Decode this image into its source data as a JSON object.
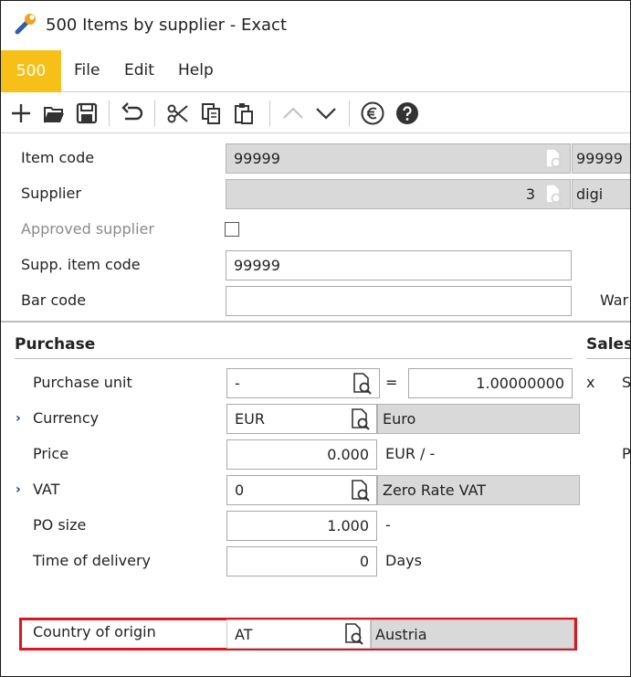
{
  "window": {
    "title": "500 Items by supplier - Exact",
    "app_icon": "wrench-icon"
  },
  "menu": {
    "code": "500",
    "items": [
      "File",
      "Edit",
      "Help"
    ]
  },
  "toolbar": {
    "icons": [
      "plus-icon",
      "folder-open-icon",
      "save-icon",
      "undo-icon",
      "cut-icon",
      "copy-icon",
      "paste-icon",
      "chevron-up-icon",
      "chevron-down-icon",
      "euro-icon",
      "help-icon"
    ]
  },
  "header": {
    "item_code": {
      "label": "Item code",
      "value": "99999",
      "description": "99999"
    },
    "supplier": {
      "label": "Supplier",
      "value": "3",
      "description": "digi"
    },
    "approved_supplier": {
      "label": "Approved supplier",
      "checked": false
    },
    "supp_item_code": {
      "label": "Supp. item code",
      "value": "99999"
    },
    "bar_code": {
      "label": "Bar code",
      "value": ""
    },
    "warehouse_label": "War"
  },
  "purchase": {
    "title": "Purchase",
    "purchase_unit": {
      "label": "Purchase unit",
      "value": "-",
      "equals": "=",
      "factor": "1.00000000",
      "times": "x"
    },
    "currency": {
      "label": "Currency",
      "value": "EUR",
      "description": "Euro"
    },
    "price": {
      "label": "Price",
      "value": "0.000",
      "unit": "EUR / -"
    },
    "vat": {
      "label": "VAT",
      "value": "0",
      "description": "Zero Rate VAT"
    },
    "po_size": {
      "label": "PO size",
      "value": "1.000",
      "unit": "-"
    },
    "time_of_delivery": {
      "label": "Time of delivery",
      "value": "0",
      "unit": "Days"
    },
    "country_of_origin": {
      "label": "Country of origin",
      "value": "AT",
      "description": "Austria"
    }
  },
  "sales": {
    "title": "Sales",
    "label_s": "S",
    "label_p": "P"
  },
  "colors": {
    "accent": "#f7c018",
    "highlight": "#e0141e",
    "readonly_bg": "#d9d9d9"
  }
}
